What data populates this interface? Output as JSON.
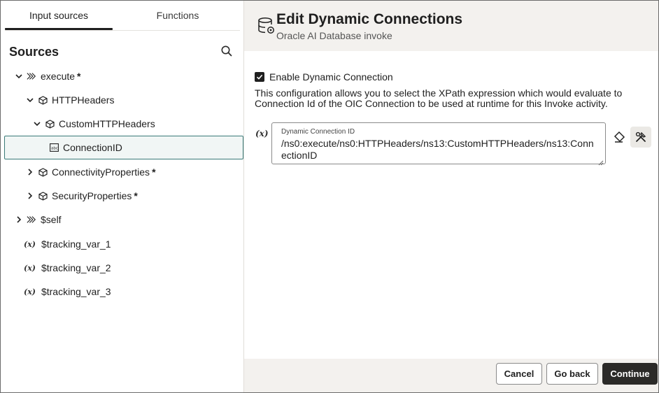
{
  "tabs": [
    "Input sources",
    "Functions"
  ],
  "sources": {
    "title": "Sources",
    "tree": [
      {
        "label": "execute",
        "star": "*"
      },
      {
        "label": "HTTPHeaders",
        "star": ""
      },
      {
        "label": "CustomHTTPHeaders",
        "star": ""
      },
      {
        "label": "ConnectionID",
        "star": ""
      },
      {
        "label": "ConnectivityProperties",
        "star": "*"
      },
      {
        "label": "SecurityProperties",
        "star": "*"
      },
      {
        "label": "$self",
        "star": ""
      },
      {
        "label": "$tracking_var_1",
        "star": ""
      },
      {
        "label": "$tracking_var_2",
        "star": ""
      },
      {
        "label": "$tracking_var_3",
        "star": ""
      }
    ],
    "var_marker": "(x)"
  },
  "header": {
    "title": "Edit Dynamic Connections",
    "subtitle": "Oracle AI Database invoke"
  },
  "form": {
    "checkbox_label": "Enable Dynamic Connection",
    "checked": true,
    "description": "This configuration allows you to select the XPath expression which would evaluate to Connection Id of the OIC Connection to be used at runtime for this Invoke activity.",
    "var_marker": "(x)",
    "field_label": "Dynamic Connection ID",
    "field_value": "/ns0:execute/ns0:HTTPHeaders/ns13:CustomHTTPHeaders/ns13:ConnectionID"
  },
  "footer": {
    "cancel": "Cancel",
    "back": "Go back",
    "continue": "Continue"
  },
  "colors": {
    "selected_border": "#3a7a78",
    "selected_bg": "#f1f6f5",
    "header_bg": "#f3f1ee",
    "primary_button": "#2b2a28"
  }
}
